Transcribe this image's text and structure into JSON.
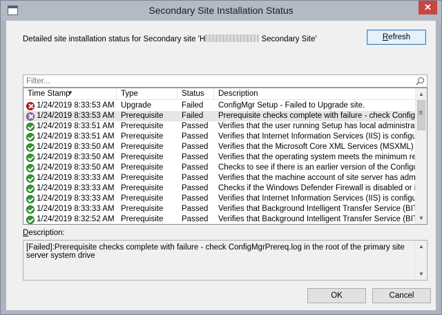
{
  "window": {
    "title": "Secondary Site Installation Status",
    "close_glyph": "✕"
  },
  "header": {
    "prefix": "Detailed site installation status for Secondary site 'H",
    "suffix": " Secondary Site'"
  },
  "refresh_button": {
    "label_accel": "R",
    "label_rest": "efresh"
  },
  "filter": {
    "placeholder": "Filter..."
  },
  "columns": {
    "timestamp": "Time Stamp",
    "type": "Type",
    "status": "Status",
    "description": "Description"
  },
  "rows": [
    {
      "icon": "fail",
      "timestamp": "1/24/2019 8:33:53 AM",
      "type": "Upgrade",
      "status": "Failed",
      "description": "ConfigMgr Setup - Failed to Upgrade site."
    },
    {
      "icon": "fail-gray",
      "timestamp": "1/24/2019 8:33:53 AM",
      "type": "Prerequisite",
      "status": "Failed",
      "description": "Prerequisite checks complete with failure - check ConfigMgrPre..."
    },
    {
      "icon": "ok",
      "timestamp": "1/24/2019 8:33:51 AM",
      "type": "Prerequisite",
      "status": "Passed",
      "description": "Verifies that the user running Setup has local administrator right..."
    },
    {
      "icon": "ok",
      "timestamp": "1/24/2019 8:33:51 AM",
      "type": "Prerequisite",
      "status": "Passed",
      "description": "Verifies that Internet Information Services (IIS) is configured for ..."
    },
    {
      "icon": "ok",
      "timestamp": "1/24/2019 8:33:50 AM",
      "type": "Prerequisite",
      "status": "Passed",
      "description": "Verifies that the Microsoft Core XML Services (MSXML) version..."
    },
    {
      "icon": "ok",
      "timestamp": "1/24/2019 8:33:50 AM",
      "type": "Prerequisite",
      "status": "Passed",
      "description": "Verifies that the operating system meets the minimum requireme..."
    },
    {
      "icon": "ok",
      "timestamp": "1/24/2019 8:33:50 AM",
      "type": "Prerequisite",
      "status": "Passed",
      "description": "Checks to see if there is an earlier version of the Configuration ..."
    },
    {
      "icon": "ok",
      "timestamp": "1/24/2019 8:33:33 AM",
      "type": "Prerequisite",
      "status": "Passed",
      "description": "Verifies that the machine account of site server has administrati..."
    },
    {
      "icon": "ok",
      "timestamp": "1/24/2019 8:33:33 AM",
      "type": "Prerequisite",
      "status": "Passed",
      "description": "Checks if the Windows Defender Firewall is disabled or if a rele..."
    },
    {
      "icon": "ok",
      "timestamp": "1/24/2019 8:33:33 AM",
      "type": "Prerequisite",
      "status": "Passed",
      "description": "Verifies that Internet Information Services (IIS) is configured for ..."
    },
    {
      "icon": "ok",
      "timestamp": "1/24/2019 8:33:33 AM",
      "type": "Prerequisite",
      "status": "Passed",
      "description": "Verifies that Background Intelligent Transfer Service (BITS) is e..."
    },
    {
      "icon": "ok",
      "timestamp": "1/24/2019 8:32:52 AM",
      "type": "Prerequisite",
      "status": "Passed",
      "description": "Verifies that Background Intelligent Transfer Service (BITS) is in..."
    }
  ],
  "description_panel": {
    "label_accel": "D",
    "label_rest": "escription:",
    "text": "[Failed]:Prerequisite checks complete with failure - check ConfigMgrPrereq.log in the root of the primary site server system drive"
  },
  "ok_button": {
    "label": "OK"
  },
  "cancel_button": {
    "label": "Cancel"
  }
}
